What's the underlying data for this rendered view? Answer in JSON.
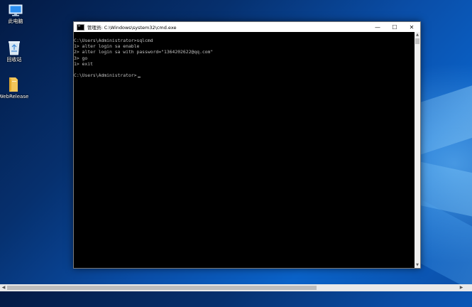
{
  "desktop": {
    "icons": [
      {
        "label": "此电脑",
        "icon": "computer-icon"
      },
      {
        "label": "回收站",
        "icon": "recycle-bin-icon"
      },
      {
        "label": "WebRelease",
        "icon": "folder-icon"
      }
    ]
  },
  "window": {
    "title": "管理员: C:\\Windows\\system32\\cmd.exe",
    "controls": {
      "minimize": "—",
      "maximize": "☐",
      "close": "✕"
    }
  },
  "console": {
    "lines": [
      "C:\\Users\\Administrator>sqlcmd",
      "1> alter login sa enable",
      "2> alter login sa with password=\"1364202622@qq.com\"",
      "3> go",
      "1> exit",
      "",
      "C:\\Users\\Administrator>"
    ]
  },
  "colors": {
    "console_bg": "#000000",
    "console_text": "#c0c0c0",
    "titlebar_bg": "#ffffff"
  }
}
